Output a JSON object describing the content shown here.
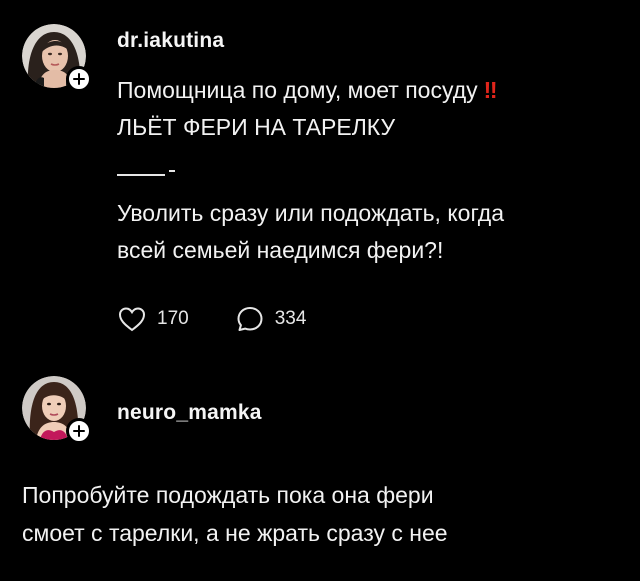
{
  "posts": [
    {
      "username": "dr.iakutina",
      "line1": "Помощница по дому, моет посуду",
      "line1_emoji": "‼",
      "line2": "ЛЬЁТ ФЕРИ НА ТАРЕЛКУ",
      "line4": "Уволить сразу или подождать, когда",
      "line5": "всей семьей наедимся фери?!",
      "likes": "170",
      "comments": "334"
    },
    {
      "username": "neuro_mamka",
      "line1": "Попробуйте подождать пока она фери",
      "line2": "смоет с тарелки, а не жрать сразу с нее"
    }
  ],
  "icons": {
    "like": "heart-icon",
    "comment": "comment-bubble-icon",
    "follow": "plus-icon"
  },
  "colors": {
    "background": "#000000",
    "text": "#f2f2f2",
    "accent_red": "#e0251b"
  }
}
